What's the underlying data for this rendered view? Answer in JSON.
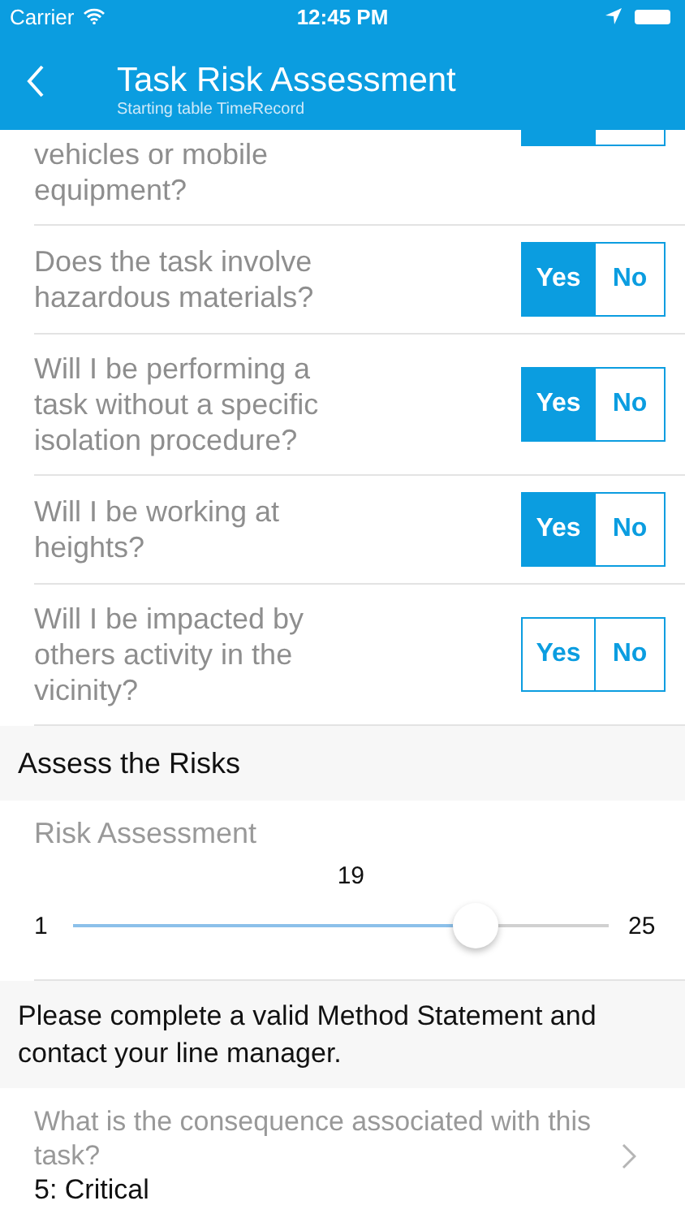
{
  "status_bar": {
    "carrier": "Carrier",
    "time": "12:45 PM"
  },
  "nav": {
    "title": "Task Risk Assessment",
    "subtitle": "Starting table TimeRecord"
  },
  "questions": [
    {
      "question": "vehicles or mobile equipment?",
      "yes_selected": true,
      "no_selected": false,
      "cut": true
    },
    {
      "question": "Does the task involve hazardous materials?",
      "yes_selected": true,
      "no_selected": false,
      "cut": false,
      "yes": "Yes",
      "no": "No"
    },
    {
      "question": "Will I be performing a task without a specific isolation procedure?",
      "yes_selected": true,
      "no_selected": false,
      "cut": false,
      "yes": "Yes",
      "no": "No"
    },
    {
      "question": "Will I be working at heights?",
      "yes_selected": true,
      "no_selected": false,
      "cut": false,
      "yes": "Yes",
      "no": "No"
    },
    {
      "question": "Will I be impacted by others activity in the vicinity?",
      "yes_selected": false,
      "no_selected": false,
      "cut": false,
      "yes": "Yes",
      "no": "No"
    }
  ],
  "section_header": "Assess the Risks",
  "risk": {
    "label": "Risk Assessment",
    "value": "19",
    "min": "1",
    "max": "25",
    "level": 0.75
  },
  "warning": "Please complete a valid Method Statement and contact your line manager.",
  "consequence": {
    "question": "What is the consequence associated with this task?",
    "value": "5: Critical"
  }
}
